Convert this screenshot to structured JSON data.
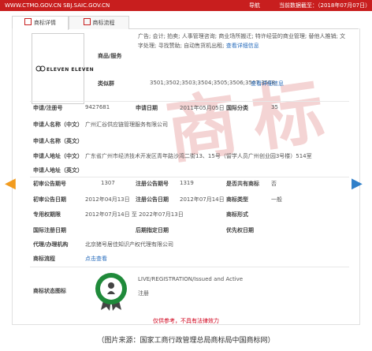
{
  "topbar": {
    "url": "WWW.CTMO.GOV.CN SBJ.SAIC.GOV.CN",
    "right_1": "导航",
    "right_2": "当前数据截至：（2018年07月07日）"
  },
  "tabs": [
    {
      "label": "商标详情",
      "active": true
    },
    {
      "label": "商标流程",
      "active": false
    }
  ],
  "logo": {
    "text": "ELEVEN ELEVEN"
  },
  "goods": {
    "label": "商品/服务",
    "value": "广告; 会计; 拍卖; 人事管理咨询; 商业场所搬迁; 特许经营的商业管理; 替他人推销; 文字处理; 寻找赞助; 自动售货机出租;",
    "more": "查看详细信息"
  },
  "similar": {
    "label": "类似群",
    "value": "3501;3502;3503;3504;3505;3506;3507;3508;",
    "more": "查看详细信息"
  },
  "reg_no": {
    "label": "申请/注册号",
    "value": "9427681"
  },
  "apply_date": {
    "label": "申请日期",
    "value": "2011年05月05日"
  },
  "intl_class": {
    "label": "国际分类",
    "value": "35"
  },
  "applicant_cn": {
    "label": "申请人名称（中文）",
    "value": "广州汇谷供应链管理服务有限公司"
  },
  "applicant_en": {
    "label": "申请人名称（英文）",
    "value": ""
  },
  "address_cn": {
    "label": "申请人地址（中文）",
    "value": "广东省广州市经济技术开发区青年路沙湾二街13、15号（留学人员广州创业园3号楼）514室"
  },
  "address_en": {
    "label": "申请人地址（英文）",
    "value": ""
  },
  "prelim_no": {
    "label": "初审公告期号",
    "value": "1307"
  },
  "reg_pub_no": {
    "label": "注册公告期号",
    "value": "1319"
  },
  "shared": {
    "label": "是否共有商标",
    "value": "否"
  },
  "prelim_date": {
    "label": "初审公告日期",
    "value": "2012年04月13日"
  },
  "reg_pub_date": {
    "label": "注册公告日期",
    "value": "2012年07月14日"
  },
  "type": {
    "label": "商标类型",
    "value": "一般"
  },
  "exclusive": {
    "label": "专用权期限",
    "value": "2012年07月14日 至 2022年07月13日"
  },
  "form": {
    "label": "商标形式",
    "value": ""
  },
  "intl_reg_date": {
    "label": "国际注册日期",
    "value": ""
  },
  "later_date": {
    "label": "后期指定日期",
    "value": ""
  },
  "priority": {
    "label": "优先权日期",
    "value": ""
  },
  "agent": {
    "label": "代理/办理机构",
    "value": "北京猪号居佳知识产权代理有限公司"
  },
  "process": {
    "label": "商标流程",
    "value": "点击查看"
  },
  "status": {
    "label": "商标状态图标",
    "value_en": "LIVE/REGISTRATION/Issued and Active",
    "value_cn": "注册"
  },
  "disclaimer": "仅供参考，不具有法律效力",
  "caption": "（图片来源：国家工商行政管理总局商标局中国商标网）",
  "colors": {
    "brand_red": "#c81e1e",
    "link_blue": "#2a6ebd",
    "badge_green": "#1f8a3a"
  }
}
